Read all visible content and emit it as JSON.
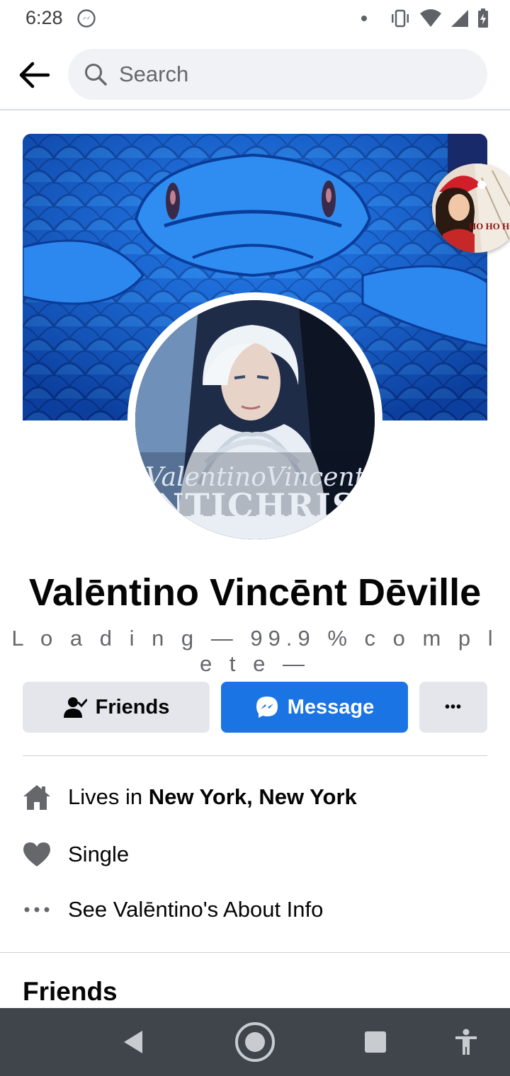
{
  "status_bar": {
    "time": "6:28"
  },
  "header": {
    "search_placeholder": "Search"
  },
  "profile": {
    "name": "Valēntino Vincēnt Dēville",
    "bio": "L o a d i n g — 99.9 % c o m p l e t e —",
    "avatar_caption_script": "ValentinoVincent",
    "avatar_caption_block": "ANTICHRIST",
    "chat_head_caption": "HO HO HO"
  },
  "actions": {
    "friends_label": "Friends",
    "message_label": "Message",
    "more_label": "•••"
  },
  "details": {
    "lives_prefix": "Lives in ",
    "lives_city": "New York, New York",
    "relationship": "Single",
    "about_link": "See Valēntino's About Info"
  },
  "sections": {
    "friends_title": "Friends"
  },
  "colors": {
    "primary_blue": "#1b74e4",
    "button_gray": "#e4e6eb",
    "nav_bar": "#3f454b"
  }
}
